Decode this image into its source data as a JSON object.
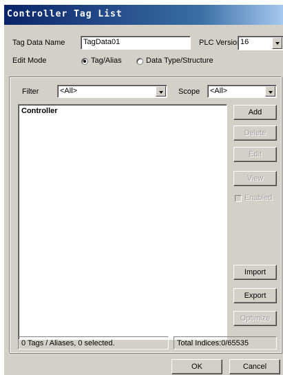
{
  "window": {
    "title": "Controller Tag List"
  },
  "header": {
    "tag_data_name_label": "Tag Data Name",
    "tag_data_name_value": "TagData01",
    "plc_version_label": "PLC Version",
    "plc_version_value": "16",
    "edit_mode_label": "Edit Mode",
    "mode_tag_alias": "Tag/Alias",
    "mode_data_type": "Data Type/Structure",
    "mode_selected": "Tag/Alias"
  },
  "filter": {
    "filter_label": "Filter",
    "filter_value": "<All>",
    "scope_label": "Scope",
    "scope_value": "<All>"
  },
  "tree": {
    "root": "Controller"
  },
  "side_buttons": {
    "add": "Add",
    "delete": "Delete",
    "edit": "Edit",
    "view": "View",
    "enabled": "Enabled",
    "import": "Import",
    "export": "Export",
    "optimize": "Optimize"
  },
  "status": {
    "selection": "0 Tags / Aliases, 0 selected.",
    "indices": "Total Indices:0/65535"
  },
  "footer": {
    "ok": "OK",
    "cancel": "Cancel"
  }
}
